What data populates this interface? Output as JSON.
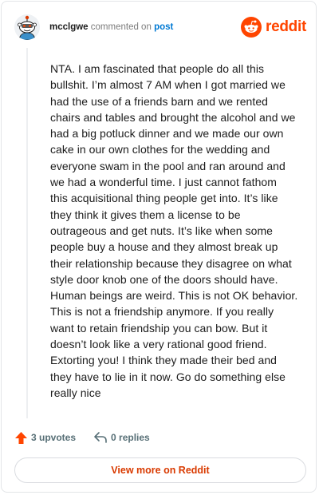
{
  "comment": {
    "username": "mcclgwe",
    "action_text": "commented on",
    "target_text": "post",
    "brand": "reddit",
    "body": "NTA. I am fascinated that people do all this\nbullshit. I’m almost 7 AM when I got married we\nhad the use of a friends barn and we rented\nchairs and tables and brought the alcohol and we\nhad a big potluck dinner and we made our own\ncake in our own clothes for the wedding and\neveryone swam in the pool and ran around and\nwe had a wonderful time. I just cannot fathom\nthis acquisitional thing people get into. It’s like\nthey think it gives them a license to be\noutrageous and get nuts. It’s like when some\npeople buy a house and they almost break up\ntheir relationship because they disagree on what\nstyle door knob one of the doors should have.\nHuman beings are weird. This is not OK behavior.\nThis is not a friendship anymore. If you really\nwant to retain friendship you can bow. But it\ndoesn’t look like a very rational good friend.\nExtorting you! I think they made their bed and\nthey have to lie in it now. Go do something else\nreally nice",
    "upvotes_label": "3 upvotes",
    "replies_label": "0 replies",
    "view_more_label": "View more on Reddit"
  },
  "icons": {
    "avatar": "snoo-avatar",
    "logo": "reddit-logo-icon",
    "upvote": "upvote-arrow-icon",
    "reply": "reply-arrow-icon"
  },
  "colors": {
    "brand": "#ff4500",
    "link": "#0079d3",
    "button_text": "#d93a00",
    "muted": "#576f76"
  }
}
